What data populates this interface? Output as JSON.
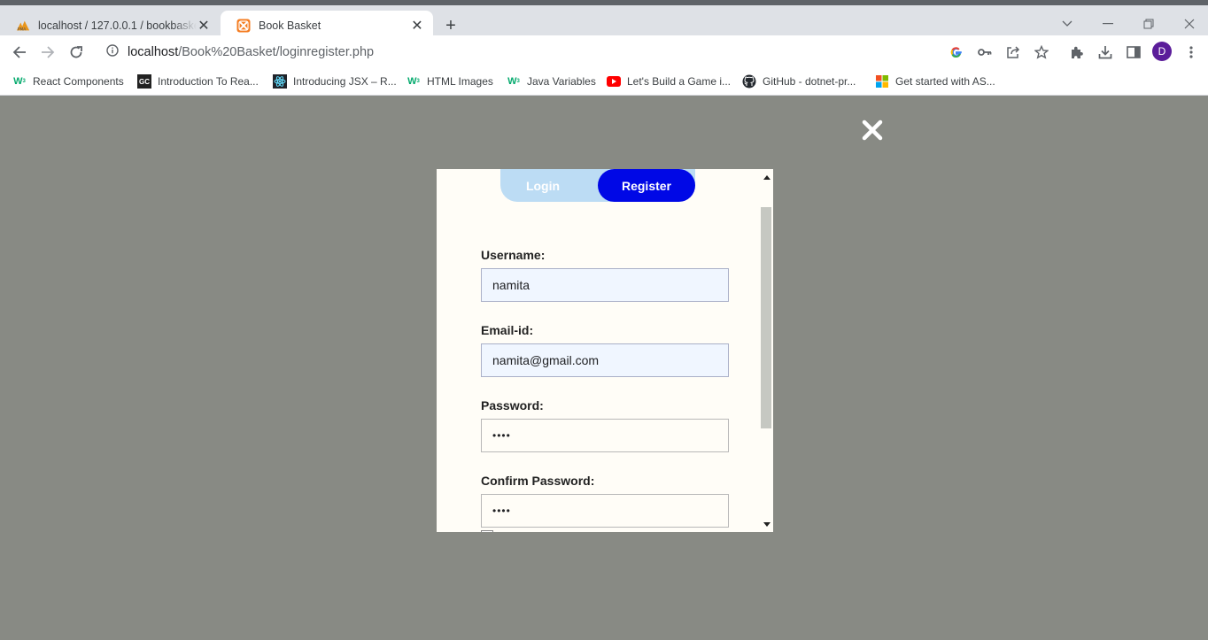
{
  "browser": {
    "tabs": [
      {
        "title": "localhost / 127.0.0.1 / bookbasket",
        "icon": "phpmyadmin-icon",
        "active": false
      },
      {
        "title": "Book Basket",
        "icon": "xampp-icon",
        "active": true
      }
    ],
    "new_tab_label": "+",
    "address": {
      "host": "localhost",
      "path": "/Book%20Basket/loginregister.php"
    },
    "profile_initial": "D",
    "bookmarks": [
      {
        "label": "React Components",
        "icon": "w3schools-icon"
      },
      {
        "label": "Introduction To Rea...",
        "icon": "gc-icon"
      },
      {
        "label": "Introducing JSX – R...",
        "icon": "react-icon"
      },
      {
        "label": "HTML Images",
        "icon": "w3schools-icon"
      },
      {
        "label": "Java Variables",
        "icon": "w3schools-icon"
      },
      {
        "label": "Let's Build a Game i...",
        "icon": "youtube-icon"
      },
      {
        "label": "GitHub - dotnet-pr...",
        "icon": "github-icon"
      },
      {
        "label": "Get started with AS...",
        "icon": "microsoft-icon"
      }
    ]
  },
  "modal": {
    "tabs": {
      "login": "Login",
      "register": "Register",
      "active": "register"
    },
    "fields": [
      {
        "label": "Username:",
        "value": "namita",
        "type": "text"
      },
      {
        "label": "Email-id:",
        "value": "namita@gmail.com",
        "type": "email"
      },
      {
        "label": "Password:",
        "value": "••••",
        "type": "password"
      },
      {
        "label": "Confirm Password:",
        "value": "••••",
        "type": "password"
      }
    ]
  },
  "colors": {
    "overlay": "#888a84",
    "modal_bg": "#fffdf7",
    "register_active": "#0008e6",
    "switcher_bg": "#bcdcf4"
  }
}
